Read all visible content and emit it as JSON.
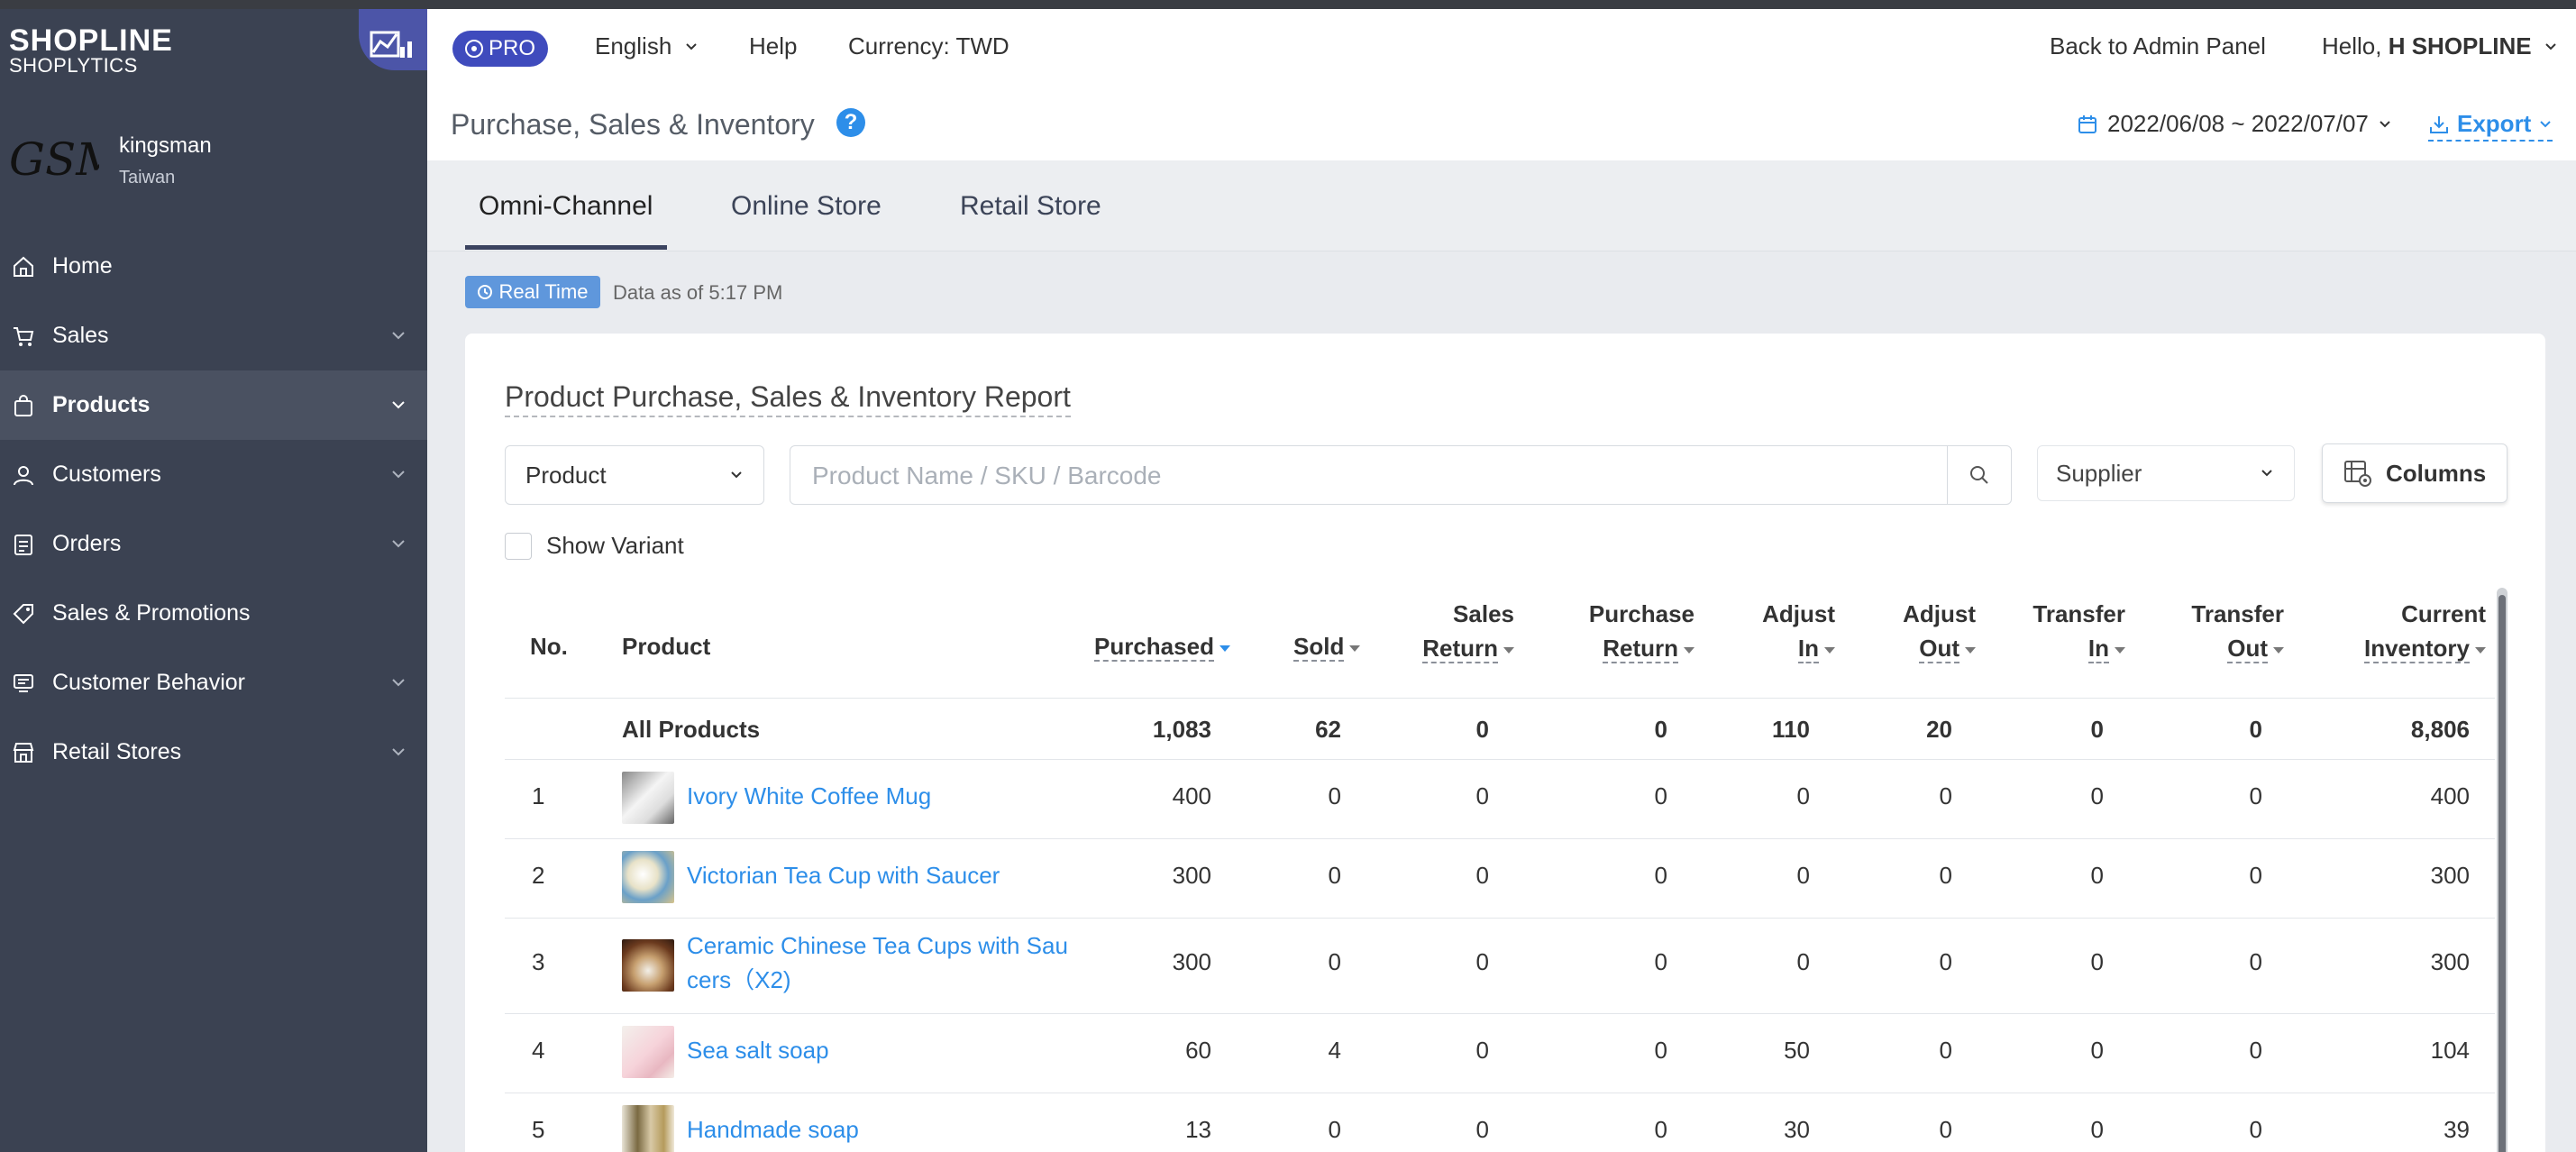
{
  "brand": {
    "name": "SHOPLINE",
    "product": "SHOPLYTICS"
  },
  "store": {
    "logo_text": "GSM",
    "name": "kingsman",
    "country": "Taiwan"
  },
  "sidebar": {
    "items": [
      {
        "label": "Home",
        "icon": "home-icon",
        "expandable": false,
        "active": false
      },
      {
        "label": "Sales",
        "icon": "cart-icon",
        "expandable": true,
        "active": false
      },
      {
        "label": "Products",
        "icon": "bag-icon",
        "expandable": true,
        "active": true
      },
      {
        "label": "Customers",
        "icon": "user-icon",
        "expandable": true,
        "active": false
      },
      {
        "label": "Orders",
        "icon": "clipboard-icon",
        "expandable": true,
        "active": false
      },
      {
        "label": "Sales & Promotions",
        "icon": "tag-icon",
        "expandable": false,
        "active": false
      },
      {
        "label": "Customer Behavior",
        "icon": "behavior-icon",
        "expandable": true,
        "active": false
      },
      {
        "label": "Retail Stores",
        "icon": "store-icon",
        "expandable": true,
        "active": false
      }
    ]
  },
  "topnav": {
    "pro_label": "PRO",
    "language": "English",
    "help": "Help",
    "currency": "Currency: TWD",
    "back": "Back to Admin Panel",
    "hello": "Hello,",
    "user": "H SHOPLINE"
  },
  "page": {
    "title": "Purchase, Sales & Inventory",
    "date_range": "2022/06/08 ~ 2022/07/07",
    "export": "Export"
  },
  "tabs": [
    {
      "label": "Omni-Channel",
      "active": true
    },
    {
      "label": "Online Store",
      "active": false
    },
    {
      "label": "Retail Store",
      "active": false
    }
  ],
  "realtime": {
    "badge": "Real Time",
    "text": "Data as of 5:17 PM"
  },
  "report": {
    "title": "Product Purchase, Sales & Inventory Report",
    "filter_type": "Product",
    "search_placeholder": "Product Name / SKU / Barcode",
    "search_value": "",
    "supplier": "Supplier",
    "columns_button": "Columns",
    "show_variant": "Show Variant",
    "show_variant_checked": false
  },
  "table": {
    "headers": {
      "no": "No.",
      "product": "Product",
      "purchased": "Purchased",
      "sold": "Sold",
      "sales_return_1": "Sales",
      "sales_return_2": "Return",
      "purchase_return_1": "Purchase",
      "purchase_return_2": "Return",
      "adjust_in_1": "Adjust",
      "adjust_in_2": "In",
      "adjust_out_1": "Adjust",
      "adjust_out_2": "Out",
      "transfer_in_1": "Transfer",
      "transfer_in_2": "In",
      "transfer_out_1": "Transfer",
      "transfer_out_2": "Out",
      "current_inventory_1": "Current",
      "current_inventory_2": "Inventory"
    },
    "total": {
      "label": "All Products",
      "purchased": "1,083",
      "sold": "62",
      "sales_return": "0",
      "purchase_return": "0",
      "adjust_in": "110",
      "adjust_out": "20",
      "transfer_in": "0",
      "transfer_out": "0",
      "current_inventory": "8,806"
    },
    "rows": [
      {
        "no": "1",
        "product": "Ivory White Coffee Mug",
        "purchased": "400",
        "sold": "0",
        "sales_return": "0",
        "purchase_return": "0",
        "adjust_in": "0",
        "adjust_out": "0",
        "transfer_in": "0",
        "transfer_out": "0",
        "current_inventory": "400"
      },
      {
        "no": "2",
        "product": "Victorian Tea Cup with Saucer",
        "purchased": "300",
        "sold": "0",
        "sales_return": "0",
        "purchase_return": "0",
        "adjust_in": "0",
        "adjust_out": "0",
        "transfer_in": "0",
        "transfer_out": "0",
        "current_inventory": "300"
      },
      {
        "no": "3",
        "product": "Ceramic Chinese Tea Cups with Saucers（X2)",
        "product_line1": "Ceramic Chinese Tea Cups with Sau",
        "product_line2": "cers（X2)",
        "purchased": "300",
        "sold": "0",
        "sales_return": "0",
        "purchase_return": "0",
        "adjust_in": "0",
        "adjust_out": "0",
        "transfer_in": "0",
        "transfer_out": "0",
        "current_inventory": "300"
      },
      {
        "no": "4",
        "product": "Sea salt soap",
        "purchased": "60",
        "sold": "4",
        "sales_return": "0",
        "purchase_return": "0",
        "adjust_in": "50",
        "adjust_out": "0",
        "transfer_in": "0",
        "transfer_out": "0",
        "current_inventory": "104"
      },
      {
        "no": "5",
        "product": "Handmade soap",
        "purchased": "13",
        "sold": "0",
        "sales_return": "0",
        "purchase_return": "0",
        "adjust_in": "30",
        "adjust_out": "0",
        "transfer_in": "0",
        "transfer_out": "0",
        "current_inventory": "39"
      }
    ]
  },
  "colors": {
    "sidebar_bg": "#3b4252",
    "sidebar_active": "#4a5161",
    "accent": "#2d8ee9",
    "pro_badge": "#3f4bbd",
    "realtime_badge": "#5f97dc"
  }
}
